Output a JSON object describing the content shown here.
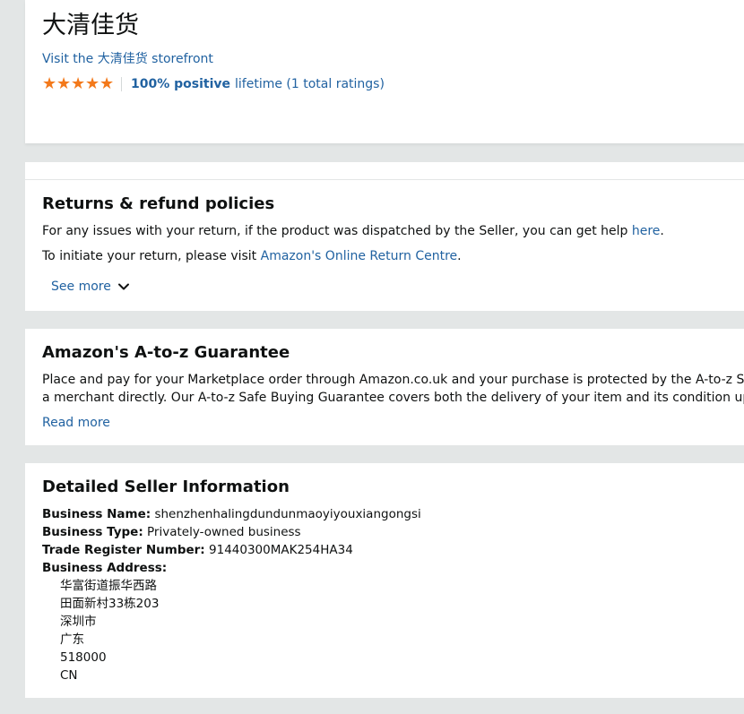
{
  "header": {
    "seller_name": "大清佳货",
    "storefront_link": "Visit the 大清佳货 storefront",
    "star_count": 5,
    "rating_positive": "100% positive",
    "rating_detail": "lifetime (1 total ratings)",
    "star_color": "#f3791b"
  },
  "returns": {
    "title": "Returns & refund policies",
    "line1_text": "For any issues with your return, if the product was dispatched by the Seller, you can get help ",
    "line1_link": "here",
    "line1_end": ".",
    "line2_text": "To initiate your return, please visit ",
    "line2_link": "Amazon's Online Return Centre",
    "line2_end": ".",
    "see_more": "See more"
  },
  "atoz": {
    "title": "Amazon's A-to-z Guarantee",
    "line1": "Place and pay for your Marketplace order through Amazon.co.uk and your purchase is protected by the A-to-z Safe Buying G",
    "line2": "a merchant directly. Our A-to-z Safe Buying Guarantee covers both the delivery of your item and its condition upon receipt.",
    "read_more": "Read more"
  },
  "detail": {
    "title": "Detailed Seller Information",
    "business_name_label": "Business Name:",
    "business_name": "shenzhenhalingdundunmaoyiyouxiangongsi",
    "business_type_label": "Business Type:",
    "business_type": "Privately-owned business",
    "trade_register_label": "Trade Register Number:",
    "trade_register": "91440300MAK254HA34",
    "address_label": "Business Address:",
    "address_lines": [
      "华富街道振华西路",
      "田面新村33栋203",
      "深圳市",
      "广东",
      "518000",
      "CN"
    ]
  },
  "colors": {
    "link": "#2162a1",
    "background": "#e3e6e6",
    "text": "#0f1111"
  }
}
